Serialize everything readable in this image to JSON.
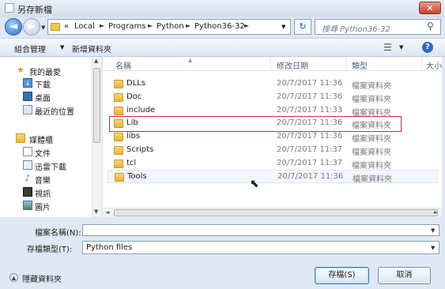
{
  "window": {
    "title": "另存新檔",
    "close_glyph": "✕"
  },
  "nav": {
    "back_glyph": "◄",
    "breadcrumb": [
      "«",
      "Local",
      "Programs",
      "Python",
      "Python36-32"
    ],
    "refresh_glyph": "↻",
    "search_placeholder": "搜尋 Python36-32"
  },
  "toolbar": {
    "organize_label": "組合管理",
    "new_folder_label": "新增資料夾"
  },
  "sidebar": {
    "items": [
      {
        "label": "我的最愛",
        "icon": "star-icon"
      },
      {
        "label": "下載",
        "icon": "download-icon"
      },
      {
        "label": "桌面",
        "icon": "desktop-icon"
      },
      {
        "label": "最近的位置",
        "icon": "recent-places-icon"
      },
      {
        "label": "媒體櫃",
        "icon": "library-icon"
      },
      {
        "label": "文件",
        "icon": "documents-icon"
      },
      {
        "label": "迅雷下載",
        "icon": "thunder-download-icon"
      },
      {
        "label": "音樂",
        "icon": "music-icon"
      },
      {
        "label": "視訊",
        "icon": "video-icon"
      },
      {
        "label": "圖片",
        "icon": "pictures-icon"
      }
    ]
  },
  "filelist": {
    "columns": [
      "名稱",
      "修改日期",
      "類型",
      "大小"
    ],
    "rows": [
      {
        "name": "DLLs",
        "date": "20/7/2017 11:36",
        "type": "檔案資料夾"
      },
      {
        "name": "Doc",
        "date": "20/7/2017 11:36",
        "type": "檔案資料夾"
      },
      {
        "name": "include",
        "date": "20/7/2017 11:33",
        "type": "檔案資料夾"
      },
      {
        "name": "Lib",
        "date": "20/7/2017 11:36",
        "type": "檔案資料夾"
      },
      {
        "name": "libs",
        "date": "20/7/2017 11:36",
        "type": "檔案資料夾"
      },
      {
        "name": "Scripts",
        "date": "20/7/2017 11:37",
        "type": "檔案資料夾"
      },
      {
        "name": "tcl",
        "date": "20/7/2017 11:37",
        "type": "檔案資料夾"
      },
      {
        "name": "Tools",
        "date": "20/7/2017 11:36",
        "type": "檔案資料夾"
      }
    ],
    "selected_row": "Lib"
  },
  "form": {
    "filename_label": "檔案名稱(N):",
    "filename_value": "",
    "filetype_label": "存檔類型(T):",
    "filetype_value": "Python files",
    "hide_folders_label": "隱藏資料夾",
    "save_label": "存檔(S)",
    "cancel_label": "取消"
  }
}
